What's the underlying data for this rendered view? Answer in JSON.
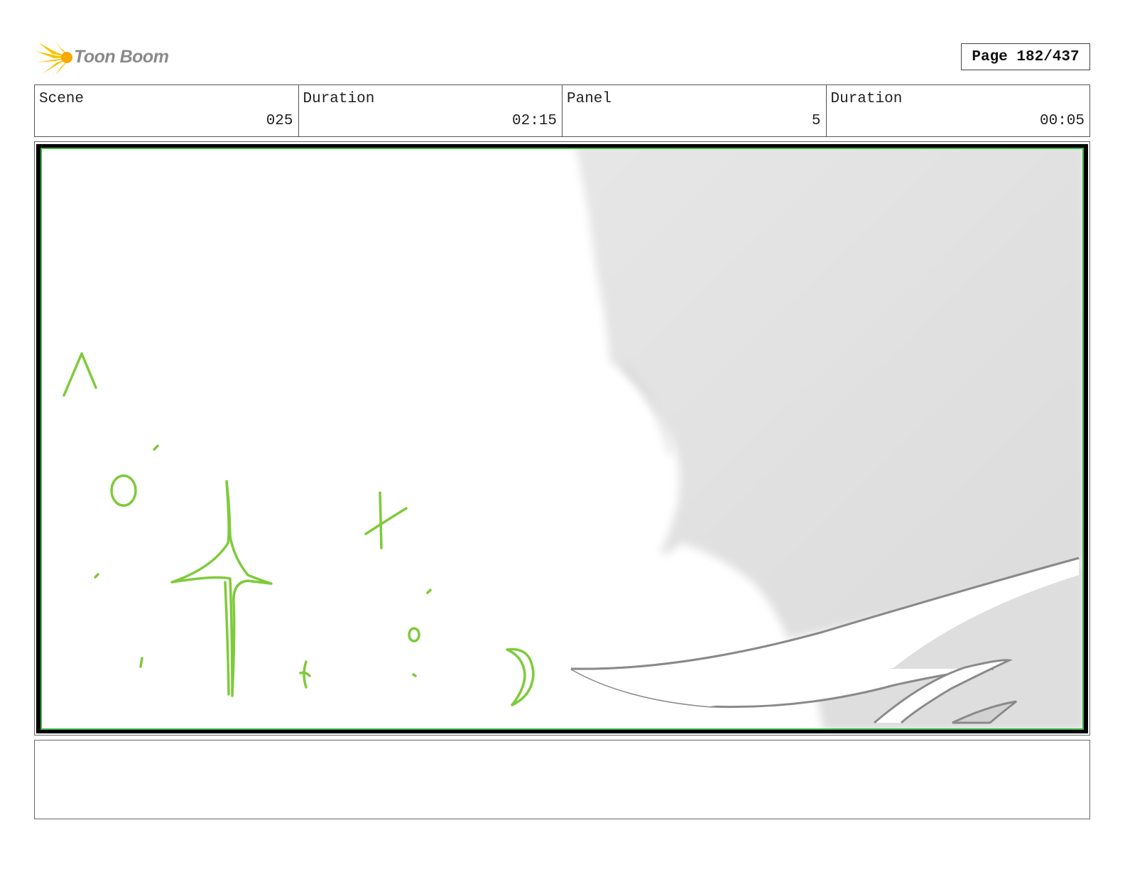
{
  "header": {
    "logo_text": "Toon Boom",
    "logo_accent": "#f5c400",
    "page_label": "Page 182/437"
  },
  "info": [
    {
      "label": "Scene",
      "value": "025"
    },
    {
      "label": "Duration",
      "value": "02:15"
    },
    {
      "label": "Panel",
      "value": "5"
    },
    {
      "label": "Duration",
      "value": "00:05"
    }
  ],
  "panel": {
    "frame_color": "#000000",
    "border_accent": "#3fb54a",
    "sketch_color": "#7ecb3a",
    "shadow_color": "#e3e3e3",
    "line_color": "#888888"
  },
  "notes": {
    "text": ""
  }
}
